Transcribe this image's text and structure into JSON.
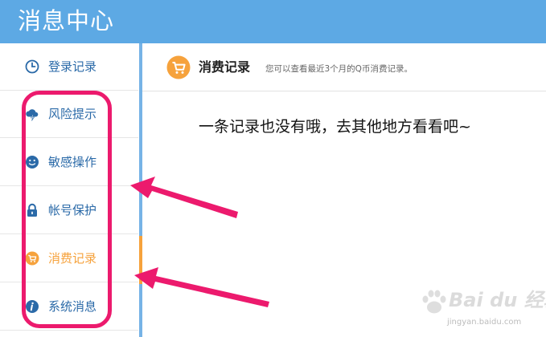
{
  "header": {
    "title": "消息中心"
  },
  "sidebar": {
    "items": [
      {
        "label": "登录记录",
        "icon": "clock-icon",
        "active": false
      },
      {
        "label": "风险提示",
        "icon": "cloud-lightning-icon",
        "active": false
      },
      {
        "label": "敏感操作",
        "icon": "smiley-icon",
        "active": false
      },
      {
        "label": "帐号保护",
        "icon": "lock-icon",
        "active": false
      },
      {
        "label": "消费记录",
        "icon": "shopping-cart-icon",
        "active": true
      },
      {
        "label": "系统消息",
        "icon": "info-icon",
        "active": false
      }
    ]
  },
  "content": {
    "title": "消费记录",
    "subtitle": "您可以查看最近3个月的Q币消费记录。",
    "empty_message": "一条记录也没有哦，去其他地方看看吧~"
  },
  "watermark": {
    "text": "Bai du 经验",
    "sub": "jingyan.baidu.com"
  },
  "colors": {
    "header_bg": "#5da9e4",
    "nav_text": "#2b6aa8",
    "active": "#f6a23c",
    "annotation": "#ec1a6d"
  }
}
